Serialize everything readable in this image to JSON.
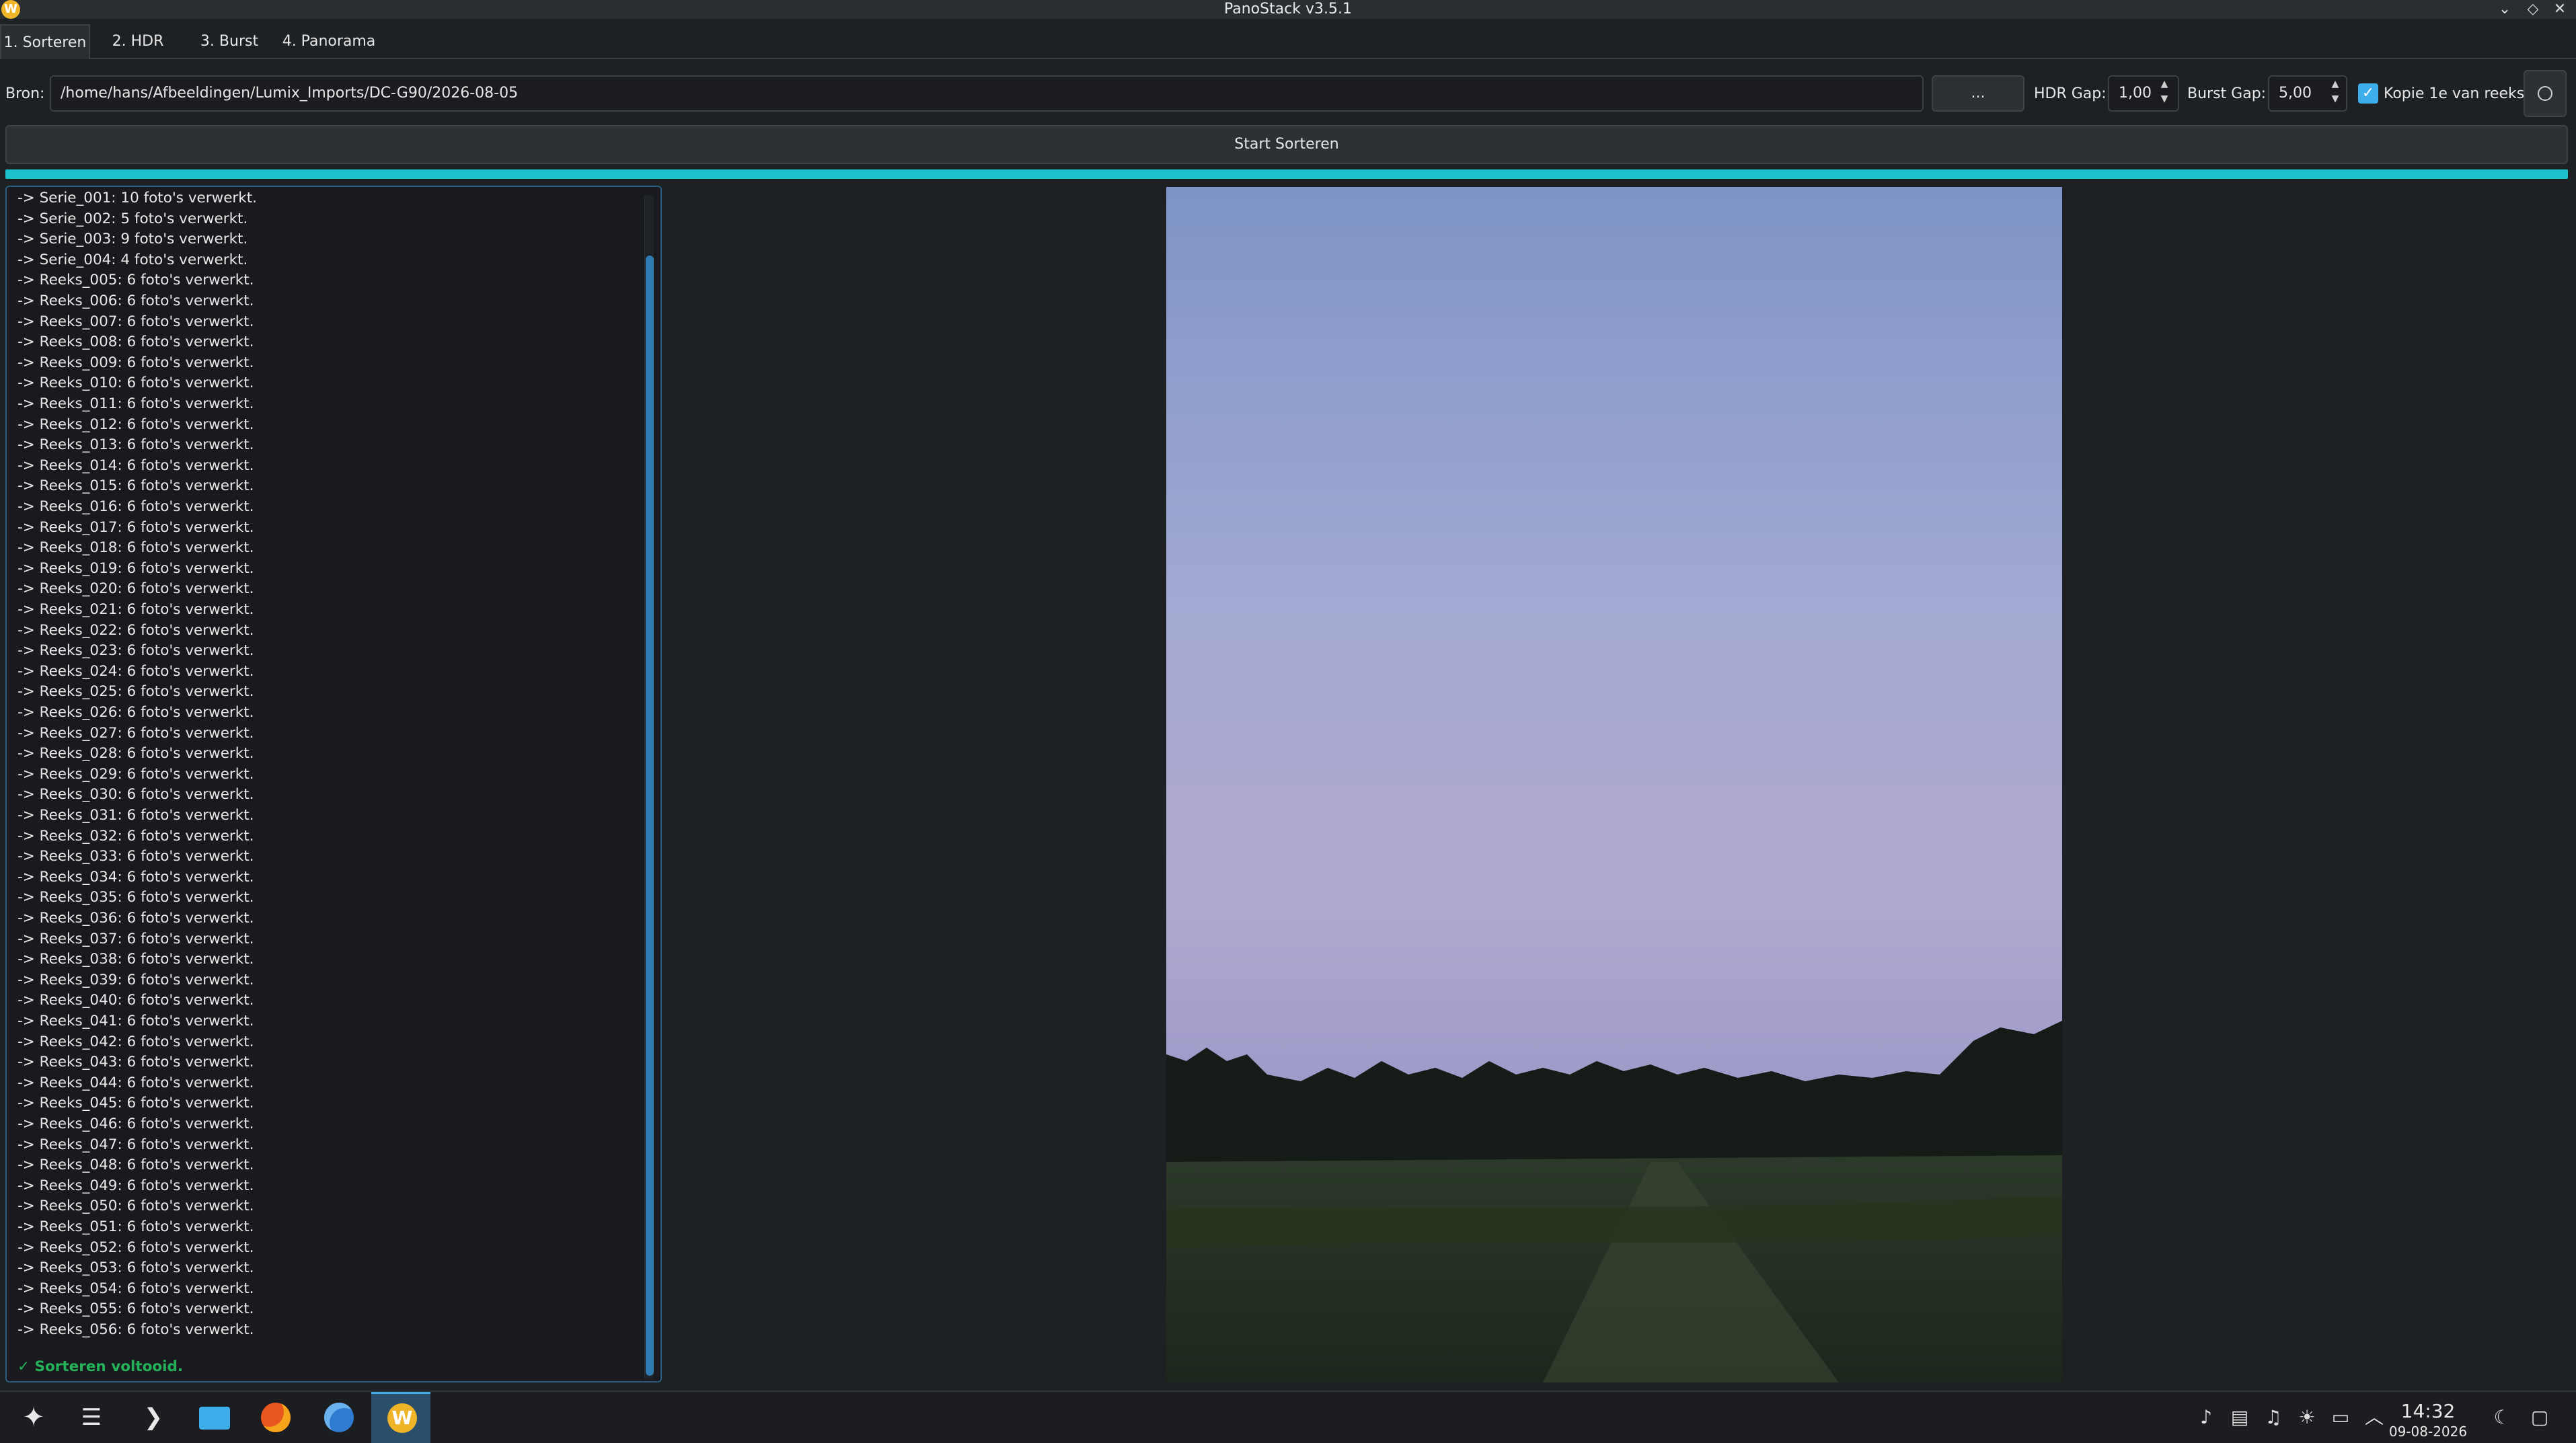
{
  "window": {
    "title": "PanoStack v3.5.1",
    "controls": [
      "⌄",
      "◇",
      "✕"
    ]
  },
  "tabs": [
    {
      "label": "1. Sorteren",
      "active": true
    },
    {
      "label": "2. HDR",
      "active": false
    },
    {
      "label": "3. Burst",
      "active": false
    },
    {
      "label": "4. Panorama",
      "active": false
    }
  ],
  "toolbar": {
    "source_label": "Bron:",
    "source_value": "/home/hans/Afbeeldingen/Lumix_Imports/DC-G90/2026-08-05",
    "browse_label": "...",
    "hdr_gap_label": "HDR Gap:",
    "hdr_gap_value": "1,00",
    "burst_gap_label": "Burst Gap:",
    "burst_gap_value": "5,00",
    "copy_first_label": "Kopie 1e van reeks",
    "copy_first_checked": true,
    "info_icon": "info-icon"
  },
  "start_button_label": "Start Sorteren",
  "progress": 1.0,
  "log": {
    "lines": [
      "-> Serie_001: 10 foto's verwerkt.",
      "-> Serie_002: 5 foto's verwerkt.",
      "-> Serie_003: 9 foto's verwerkt.",
      "-> Serie_004: 4 foto's verwerkt.",
      "-> Reeks_005: 6 foto's verwerkt.",
      "-> Reeks_006: 6 foto's verwerkt.",
      "-> Reeks_007: 6 foto's verwerkt.",
      "-> Reeks_008: 6 foto's verwerkt.",
      "-> Reeks_009: 6 foto's verwerkt.",
      "-> Reeks_010: 6 foto's verwerkt.",
      "-> Reeks_011: 6 foto's verwerkt.",
      "-> Reeks_012: 6 foto's verwerkt.",
      "-> Reeks_013: 6 foto's verwerkt.",
      "-> Reeks_014: 6 foto's verwerkt.",
      "-> Reeks_015: 6 foto's verwerkt.",
      "-> Reeks_016: 6 foto's verwerkt.",
      "-> Reeks_017: 6 foto's verwerkt.",
      "-> Reeks_018: 6 foto's verwerkt.",
      "-> Reeks_019: 6 foto's verwerkt.",
      "-> Reeks_020: 6 foto's verwerkt.",
      "-> Reeks_021: 6 foto's verwerkt.",
      "-> Reeks_022: 6 foto's verwerkt.",
      "-> Reeks_023: 6 foto's verwerkt.",
      "-> Reeks_024: 6 foto's verwerkt.",
      "-> Reeks_025: 6 foto's verwerkt.",
      "-> Reeks_026: 6 foto's verwerkt.",
      "-> Reeks_027: 6 foto's verwerkt.",
      "-> Reeks_028: 6 foto's verwerkt.",
      "-> Reeks_029: 6 foto's verwerkt.",
      "-> Reeks_030: 6 foto's verwerkt.",
      "-> Reeks_031: 6 foto's verwerkt.",
      "-> Reeks_032: 6 foto's verwerkt.",
      "-> Reeks_033: 6 foto's verwerkt.",
      "-> Reeks_034: 6 foto's verwerkt.",
      "-> Reeks_035: 6 foto's verwerkt.",
      "-> Reeks_036: 6 foto's verwerkt.",
      "-> Reeks_037: 6 foto's verwerkt.",
      "-> Reeks_038: 6 foto's verwerkt.",
      "-> Reeks_039: 6 foto's verwerkt.",
      "-> Reeks_040: 6 foto's verwerkt.",
      "-> Reeks_041: 6 foto's verwerkt.",
      "-> Reeks_042: 6 foto's verwerkt.",
      "-> Reeks_043: 6 foto's verwerkt.",
      "-> Reeks_044: 6 foto's verwerkt.",
      "-> Reeks_045: 6 foto's verwerkt.",
      "-> Reeks_046: 6 foto's verwerkt.",
      "-> Reeks_047: 6 foto's verwerkt.",
      "-> Reeks_048: 6 foto's verwerkt.",
      "-> Reeks_049: 6 foto's verwerkt.",
      "-> Reeks_050: 6 foto's verwerkt.",
      "-> Reeks_051: 6 foto's verwerkt.",
      "-> Reeks_052: 6 foto's verwerkt.",
      "-> Reeks_053: 6 foto's verwerkt.",
      "-> Reeks_054: 6 foto's verwerkt.",
      "-> Reeks_055: 6 foto's verwerkt.",
      "-> Reeks_056: 6 foto's verwerkt."
    ],
    "done": "✓ Sorteren voltooid."
  },
  "taskbar": {
    "apps": [
      "launcher-icon",
      "overview-icon",
      "terminal-icon",
      "file-manager-icon",
      "firefox-icon",
      "thunderbird-icon",
      "panostack-icon"
    ],
    "tray": [
      "notifications-icon",
      "clipboard-icon",
      "volume-icon",
      "brightness-icon",
      "network-icon",
      "tray-expand-icon"
    ],
    "time": "14:32",
    "date": "09-08-2026"
  },
  "colors": {
    "accent": "#3daee9",
    "progress": "#1ac1cc",
    "success": "#26b25a",
    "background": "#1e2124"
  }
}
